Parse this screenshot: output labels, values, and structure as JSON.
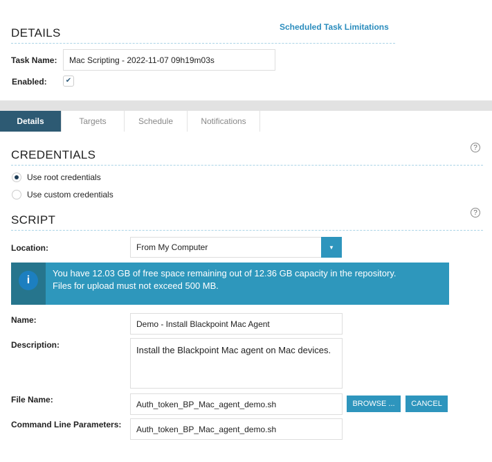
{
  "details": {
    "title": "DETAILS",
    "limitations_link": "Scheduled Task Limitations",
    "task_name_label": "Task Name:",
    "task_name_value": "Mac Scripting - 2022-11-07 09h19m03s",
    "enabled_label": "Enabled:",
    "enabled": true
  },
  "tabs": [
    {
      "label": "Details",
      "active": true
    },
    {
      "label": "Targets"
    },
    {
      "label": "Schedule"
    },
    {
      "label": "Notifications"
    }
  ],
  "credentials": {
    "title": "CREDENTIALS",
    "options": [
      "Use root credentials",
      "Use custom credentials"
    ],
    "selected": 0
  },
  "script": {
    "title": "SCRIPT",
    "location_label": "Location:",
    "location_value": "From My Computer",
    "info_line1": "You have 12.03 GB of free space remaining out of 12.36 GB capacity in the repository.",
    "info_line2": "Files for upload must not exceed 500 MB.",
    "name_label": "Name:",
    "name_value": "Demo - Install Blackpoint Mac Agent",
    "description_label": "Description:",
    "description_value": "Install the Blackpoint Mac agent on Mac devices.",
    "file_name_label": "File Name:",
    "file_name_value": "Auth_token_BP_Mac_agent_demo.sh",
    "browse_label": "BROWSE ...",
    "cancel_label": "CANCEL",
    "params_label": "Command Line Parameters:",
    "params_value": "Auth_token_BP_Mac_agent_demo.sh"
  },
  "help_icon": "?"
}
